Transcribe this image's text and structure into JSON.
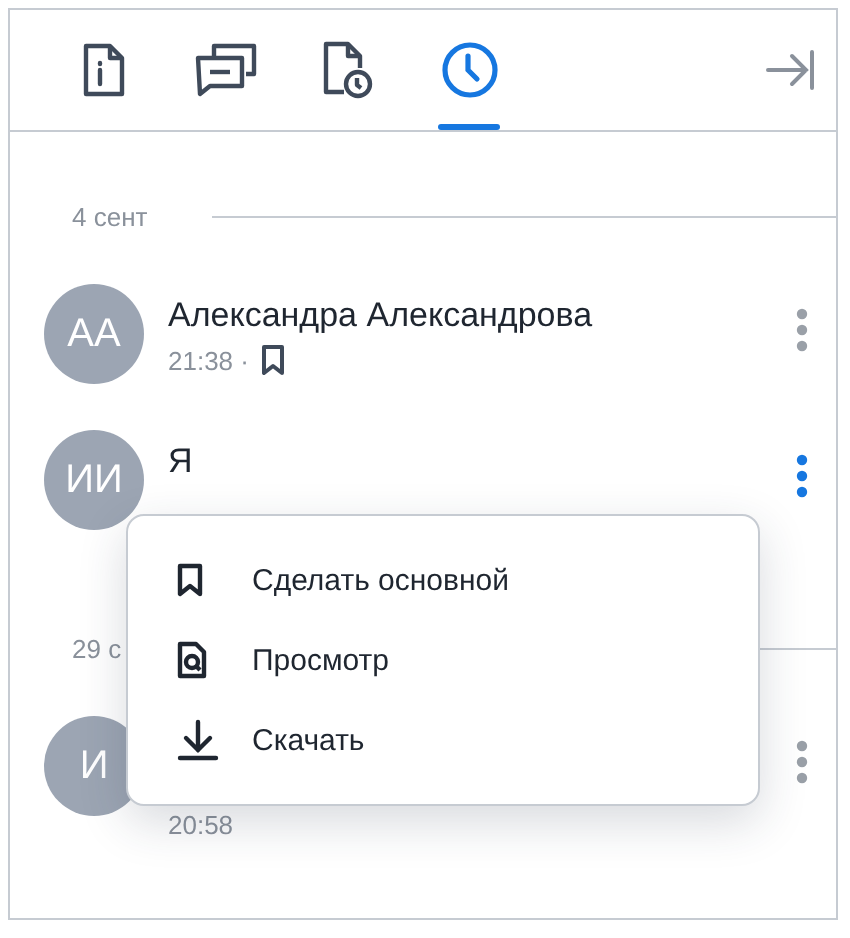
{
  "tabs": [
    {
      "kind": "info",
      "selected": false
    },
    {
      "kind": "comments",
      "selected": false
    },
    {
      "kind": "file-history",
      "selected": false
    },
    {
      "kind": "history",
      "selected": true
    }
  ],
  "history": [
    {
      "kind": "date",
      "label": "4 сент"
    },
    {
      "kind": "entry",
      "initials": "АА",
      "name": "Александра Александрова",
      "time": "21:38 ·",
      "primary": true,
      "menu_open": false
    },
    {
      "kind": "entry",
      "initials": "ИИ",
      "name": "Я",
      "menu_open": true
    },
    {
      "kind": "date",
      "label": "29 с"
    },
    {
      "kind": "entry",
      "initials": "И",
      "time": "20:58",
      "menu_open": false
    }
  ],
  "context_menu": [
    {
      "kind": "bookmark",
      "label": "Сделать основной"
    },
    {
      "kind": "preview",
      "label": "Просмотр"
    },
    {
      "kind": "download",
      "label": "Скачать"
    }
  ]
}
